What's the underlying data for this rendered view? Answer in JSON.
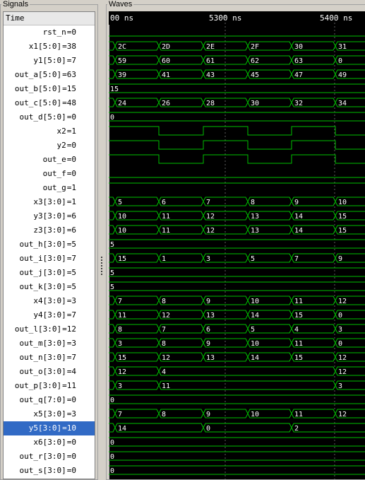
{
  "panes": {
    "signals_title": "Signals",
    "waves_title": "Waves"
  },
  "time_header": "Time",
  "timeline": {
    "labels": [
      {
        "text": "00 ns"
      },
      {
        "text": "5300 ns"
      },
      {
        "text": "5400 ns"
      }
    ]
  },
  "colors": {
    "wave": "#00c000",
    "text": "#ffffff",
    "grid": "#606060",
    "cursor": "#c0c0c0",
    "background": "#000000",
    "selection": "#316ac5"
  },
  "signals": [
    {
      "name": "rst_n",
      "value": "0",
      "kind": "bit",
      "edges": [],
      "level0": 0
    },
    {
      "name": "x1[5:0]",
      "value": "38",
      "kind": "bus",
      "segments": [
        "2C",
        "2D",
        "2E",
        "2F",
        "30",
        "31"
      ]
    },
    {
      "name": "y1[5:0]",
      "value": "7",
      "kind": "bus",
      "segments": [
        "59",
        "60",
        "61",
        "62",
        "63",
        "0"
      ]
    },
    {
      "name": "out_a[5:0]",
      "value": "63",
      "kind": "bus",
      "segments": [
        "39",
        "41",
        "43",
        "45",
        "47",
        "49"
      ]
    },
    {
      "name": "out_b[5:0]",
      "value": "15",
      "kind": "bus",
      "segments": [
        "15"
      ]
    },
    {
      "name": "out_c[5:0]",
      "value": "48",
      "kind": "bus",
      "segments": [
        "24",
        "26",
        "28",
        "30",
        "32",
        "34"
      ]
    },
    {
      "name": "out_d[5:0]",
      "value": "0",
      "kind": "bus",
      "segments": [
        "0"
      ]
    },
    {
      "name": "x2",
      "value": "1",
      "kind": "bit",
      "edges": [
        1,
        2,
        3,
        4,
        5
      ],
      "level0": 1
    },
    {
      "name": "y2",
      "value": "0",
      "kind": "bit",
      "edges": [
        1,
        2,
        3,
        4,
        5
      ],
      "level0": 1
    },
    {
      "name": "out_e",
      "value": "0",
      "kind": "bit",
      "edges": [
        1,
        2,
        3,
        4,
        5
      ],
      "level0": 1
    },
    {
      "name": "out_f",
      "value": "0",
      "kind": "bit",
      "edges": [],
      "level0": 0
    },
    {
      "name": "out_g",
      "value": "1",
      "kind": "bit",
      "edges": [],
      "level0": 1
    },
    {
      "name": "x3[3:0]",
      "value": "1",
      "kind": "bus",
      "segments": [
        "5",
        "6",
        "7",
        "8",
        "9",
        "10"
      ]
    },
    {
      "name": "y3[3:0]",
      "value": "6",
      "kind": "bus",
      "segments": [
        "10",
        "11",
        "12",
        "13",
        "14",
        "15"
      ]
    },
    {
      "name": "z3[3:0]",
      "value": "6",
      "kind": "bus",
      "segments": [
        "10",
        "11",
        "12",
        "13",
        "14",
        "15"
      ]
    },
    {
      "name": "out_h[3:0]",
      "value": "5",
      "kind": "bus",
      "segments": [
        "5"
      ]
    },
    {
      "name": "out_i[3:0]",
      "value": "7",
      "kind": "bus",
      "segments": [
        "15",
        "1",
        "3",
        "5",
        "7",
        "9"
      ]
    },
    {
      "name": "out_j[3:0]",
      "value": "5",
      "kind": "bus",
      "segments": [
        "5"
      ]
    },
    {
      "name": "out_k[3:0]",
      "value": "5",
      "kind": "bus",
      "segments": [
        "5"
      ]
    },
    {
      "name": "x4[3:0]",
      "value": "3",
      "kind": "bus",
      "segments": [
        "7",
        "8",
        "9",
        "10",
        "11",
        "12"
      ]
    },
    {
      "name": "y4[3:0]",
      "value": "7",
      "kind": "bus",
      "segments": [
        "11",
        "12",
        "13",
        "14",
        "15",
        "0"
      ]
    },
    {
      "name": "out_l[3:0]",
      "value": "12",
      "kind": "bus",
      "segments": [
        "8",
        "7",
        "6",
        "5",
        "4",
        "3"
      ]
    },
    {
      "name": "out_m[3:0]",
      "value": "3",
      "kind": "bus",
      "segments": [
        "3",
        "8",
        "9",
        "10",
        "11",
        "0"
      ]
    },
    {
      "name": "out_n[3:0]",
      "value": "7",
      "kind": "bus",
      "segments": [
        "15",
        "12",
        "13",
        "14",
        "15",
        "12"
      ]
    },
    {
      "name": "out_o[3:0]",
      "value": "4",
      "kind": "bus",
      "segments": [
        "12",
        "4",
        "",
        "",
        "",
        "12"
      ]
    },
    {
      "name": "out_p[3:0]",
      "value": "11",
      "kind": "bus",
      "segments": [
        "3",
        "11",
        "",
        "",
        "",
        "3"
      ]
    },
    {
      "name": "out_q[7:0]",
      "value": "0",
      "kind": "bus",
      "segments": [
        "0"
      ]
    },
    {
      "name": "x5[3:0]",
      "value": "3",
      "kind": "bus",
      "segments": [
        "7",
        "8",
        "9",
        "10",
        "11",
        "12"
      ]
    },
    {
      "name": "y5[3:0]",
      "value": "10",
      "kind": "bus",
      "segments": [
        "14",
        "",
        "0",
        "",
        "2",
        ""
      ],
      "selected": true
    },
    {
      "name": "x6[3:0]",
      "value": "0",
      "kind": "bus",
      "segments": [
        "0"
      ]
    },
    {
      "name": "out_r[3:0]",
      "value": "0",
      "kind": "bus",
      "segments": [
        "0"
      ]
    },
    {
      "name": "out_s[3:0]",
      "value": "0",
      "kind": "bus",
      "segments": [
        "0"
      ]
    }
  ]
}
